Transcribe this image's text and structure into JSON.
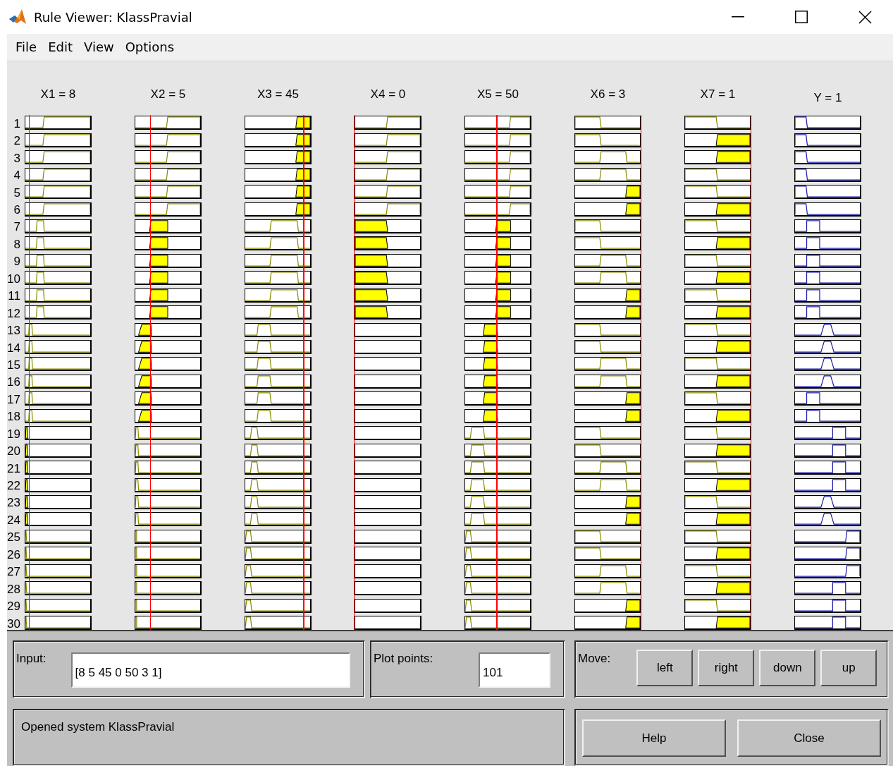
{
  "window": {
    "title": "Rule Viewer: KlassPravial"
  },
  "menu": [
    "File",
    "Edit",
    "View",
    "Options"
  ],
  "variables": [
    {
      "label": "X1 = 8",
      "kind": "input"
    },
    {
      "label": "X2 = 5",
      "kind": "input"
    },
    {
      "label": "X3 = 45",
      "kind": "input"
    },
    {
      "label": "X4 = 0",
      "kind": "input"
    },
    {
      "label": "X5 = 50",
      "kind": "input"
    },
    {
      "label": "X6 = 3",
      "kind": "input"
    },
    {
      "label": "X7 = 1",
      "kind": "input"
    },
    {
      "label": "Y = 1",
      "kind": "output"
    }
  ],
  "rules": [
    "1",
    "2",
    "3",
    "4",
    "5",
    "6",
    "7",
    "8",
    "9",
    "10",
    "11",
    "12",
    "13",
    "14",
    "15",
    "16",
    "17",
    "18",
    "19",
    "20",
    "21",
    "22",
    "23",
    "24",
    "25",
    "26",
    "27",
    "28",
    "29",
    "30"
  ],
  "input": {
    "label": "Input:",
    "value": "[8 5 45 0 50 3 1]"
  },
  "plot_points": {
    "label": "Plot points:",
    "value": "101"
  },
  "move": {
    "label": "Move:",
    "buttons": [
      "left",
      "right",
      "down",
      "up"
    ]
  },
  "status": "Opened system KlassPravial",
  "buttons": [
    "Help",
    "Close"
  ]
}
